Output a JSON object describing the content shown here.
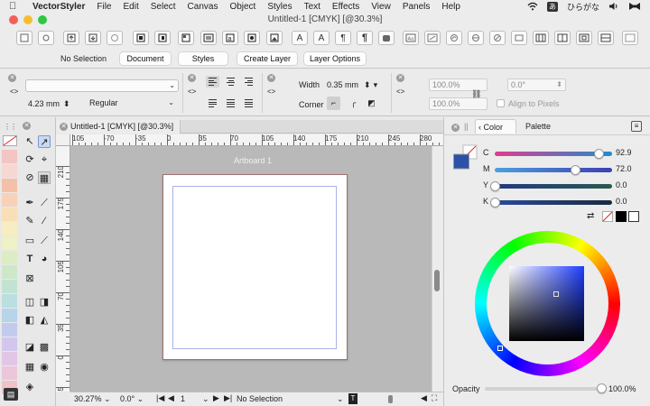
{
  "menubar": {
    "app": "VectorStyler",
    "items": [
      "File",
      "Edit",
      "Select",
      "Canvas",
      "Object",
      "Styles",
      "Text",
      "Effects",
      "View",
      "Panels",
      "Help"
    ],
    "input_method": "ひらがな"
  },
  "window": {
    "title": "Untitled-1 [CMYK] [@30.3%]"
  },
  "buttons": {
    "selection_label": "No Selection",
    "document": "Document",
    "styles": "Styles",
    "create_layer": "Create Layer",
    "layer_options": "Layer Options"
  },
  "props": {
    "font_size": "4.23 mm",
    "font_style": "Regular",
    "width_label": "Width",
    "width_value": "0.35 mm",
    "corner_label": "Corner",
    "scale_x": "100.0%",
    "scale_y": "100.0%",
    "rotation": "0.0°",
    "align_pixels": "Align to Pixels"
  },
  "document": {
    "tab_label": "Untitled-1 [CMYK] [@30.3%]",
    "artboard_label": "Artboard 1",
    "hruler_ticks": [
      "105",
      "-70",
      "-35",
      "0",
      "35",
      "70",
      "105",
      "140",
      "175",
      "210",
      "245",
      "280"
    ],
    "vruler_ticks": [
      "210",
      "175",
      "140",
      "105",
      "70",
      "35",
      "0",
      "-35"
    ]
  },
  "status": {
    "zoom": "30.27%",
    "rotation": "0.0°",
    "page": "1",
    "selection": "No Selection"
  },
  "color_panel": {
    "tab_color": "Color",
    "tab_palette": "Palette",
    "channels": [
      {
        "label": "C",
        "value": "92.9",
        "fraction": 0.929
      },
      {
        "label": "M",
        "value": "72.0",
        "fraction": 0.72
      },
      {
        "label": "Y",
        "value": "0.0",
        "fraction": 0.0
      },
      {
        "label": "K",
        "value": "0.0",
        "fraction": 0.0
      }
    ],
    "current_color": "#2b52a8",
    "opacity_label": "Opacity",
    "opacity_value": "100.0%",
    "opacity_fraction": 1.0
  }
}
